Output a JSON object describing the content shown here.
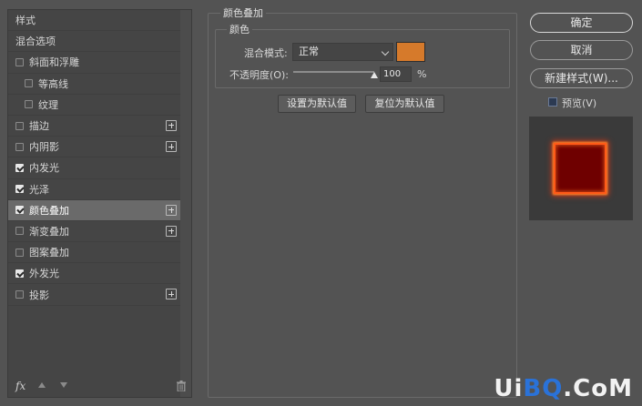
{
  "left_panel": {
    "items": [
      {
        "label": "样式",
        "checkbox": false,
        "checked": false,
        "plus": false,
        "indent": 0
      },
      {
        "label": "混合选项",
        "checkbox": false,
        "checked": false,
        "plus": false,
        "indent": 0
      },
      {
        "label": "斜面和浮雕",
        "checkbox": true,
        "checked": false,
        "plus": false,
        "indent": 0
      },
      {
        "label": "等高线",
        "checkbox": true,
        "checked": false,
        "plus": false,
        "indent": 1
      },
      {
        "label": "纹理",
        "checkbox": true,
        "checked": false,
        "plus": false,
        "indent": 1
      },
      {
        "label": "描边",
        "checkbox": true,
        "checked": false,
        "plus": true,
        "indent": 0
      },
      {
        "label": "内阴影",
        "checkbox": true,
        "checked": false,
        "plus": true,
        "indent": 0
      },
      {
        "label": "内发光",
        "checkbox": true,
        "checked": true,
        "plus": false,
        "indent": 0
      },
      {
        "label": "光泽",
        "checkbox": true,
        "checked": true,
        "plus": false,
        "indent": 0
      },
      {
        "label": "颜色叠加",
        "checkbox": true,
        "checked": true,
        "plus": true,
        "indent": 0,
        "selected": true
      },
      {
        "label": "渐变叠加",
        "checkbox": true,
        "checked": false,
        "plus": true,
        "indent": 0
      },
      {
        "label": "图案叠加",
        "checkbox": true,
        "checked": false,
        "plus": false,
        "indent": 0
      },
      {
        "label": "外发光",
        "checkbox": true,
        "checked": true,
        "plus": false,
        "indent": 0
      },
      {
        "label": "投影",
        "checkbox": true,
        "checked": false,
        "plus": true,
        "indent": 0
      }
    ],
    "footer": {
      "fx_label": "fx"
    }
  },
  "color_overlay": {
    "title": "颜色叠加",
    "group_title": "颜色",
    "blend_mode_label": "混合模式:",
    "blend_mode_value": "正常",
    "overlay_color": "#d67a2b",
    "opacity_label": "不透明度(O):",
    "opacity_value": "100",
    "opacity_unit": "%",
    "opacity_fraction": 1.0,
    "set_default_label": "设置为默认值",
    "reset_default_label": "复位为默认值"
  },
  "right_panel": {
    "ok_label": "确定",
    "cancel_label": "取消",
    "new_style_label": "新建样式(W)...",
    "preview_label": "预览(V)",
    "preview_checked": true
  },
  "watermark": {
    "text_a": "Ui",
    "text_b": "BQ",
    "text_c": ".CoM"
  }
}
